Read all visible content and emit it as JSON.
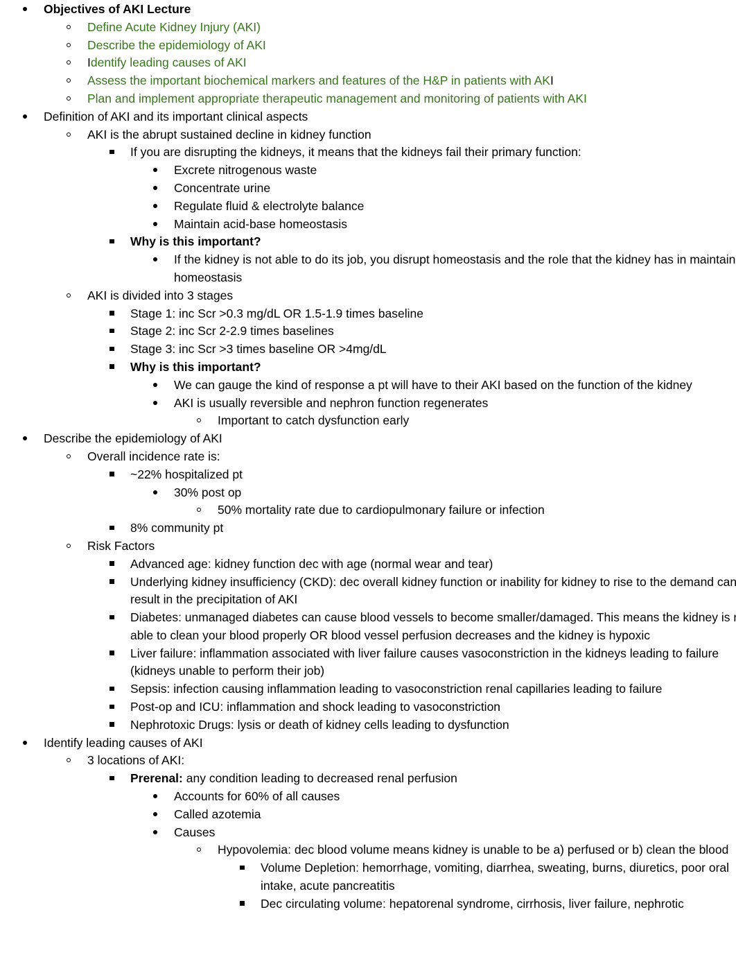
{
  "document": {
    "accent_green": "#38761d",
    "text_color": "#000000",
    "background": "#ffffff",
    "bullet_markers": {
      "level1": "filled-disc",
      "level2": "hollow-circle",
      "level3": "filled-square",
      "level4": "filled-disc",
      "level5": "hollow-circle",
      "level6": "filled-square"
    },
    "outline": [
      {
        "id": "obj-heading",
        "level": 1,
        "bullet": "disc",
        "bold": true,
        "color": "black",
        "text": "Objectives of AKI Lecture"
      },
      {
        "id": "obj-1",
        "level": 2,
        "bullet": "circ",
        "color": "green",
        "text": "Define Acute Kidney Injury (AKI)"
      },
      {
        "id": "obj-2",
        "level": 2,
        "bullet": "circ",
        "color": "green",
        "text": "Describe the epidemiology of AKI"
      },
      {
        "id": "obj-3",
        "level": 2,
        "bullet": "circ",
        "color": "green",
        "text_lead_black": "I",
        "text_rest_green": "dentify leading causes of AKI"
      },
      {
        "id": "obj-4",
        "level": 2,
        "bullet": "circ",
        "color": "green",
        "text_rest_green": "Assess the important biochemical markers and features of the H&P in patients with AK",
        "text_tail_black": "I"
      },
      {
        "id": "obj-5",
        "level": 2,
        "bullet": "circ",
        "color": "green",
        "text": "Plan and implement appropriate therapeutic management and monitoring of patients with AKI"
      },
      {
        "id": "def-heading",
        "level": 1,
        "bullet": "disc",
        "text": "Definition of AKI and its important clinical aspects"
      },
      {
        "id": "def-1",
        "level": 2,
        "bullet": "circ",
        "text": "AKI is the abrupt sustained decline in kidney function"
      },
      {
        "id": "def-1-a",
        "level": 3,
        "bullet": "sq",
        "text": "If you are disrupting the kidneys, it means that the kidneys fail their primary function:"
      },
      {
        "id": "fn-1",
        "level": 4,
        "bullet": "disc",
        "text": "Excrete nitrogenous waste"
      },
      {
        "id": "fn-2",
        "level": 4,
        "bullet": "disc",
        "text": "Concentrate urine"
      },
      {
        "id": "fn-3",
        "level": 4,
        "bullet": "disc",
        "text": "Regulate fluid & electrolyte balance"
      },
      {
        "id": "fn-4",
        "level": 4,
        "bullet": "disc",
        "text": "Maintain acid-base homeostasis"
      },
      {
        "id": "why-1",
        "level": 3,
        "bullet": "sq",
        "bold": true,
        "text": "Why is this important?"
      },
      {
        "id": "why-1-a",
        "level": 4,
        "bullet": "disc",
        "text": "If the kidney is not able to do its job, you disrupt homeostasis and the role that the kidney has in maintaining homeostasis"
      },
      {
        "id": "stages-heading",
        "level": 2,
        "bullet": "circ",
        "text": "AKI is divided into 3 stages"
      },
      {
        "id": "stage-1",
        "level": 3,
        "bullet": "sq",
        "text": "Stage 1: inc Scr >0.3 mg/dL OR 1.5-1.9 times baseline"
      },
      {
        "id": "stage-2",
        "level": 3,
        "bullet": "sq",
        "text": "Stage 2: inc Scr 2-2.9 times baselines"
      },
      {
        "id": "stage-3",
        "level": 3,
        "bullet": "sq",
        "text": "Stage 3: inc Scr >3 times baseline OR >4mg/dL"
      },
      {
        "id": "why-2",
        "level": 3,
        "bullet": "sq",
        "bold": true,
        "text": "Why is this important?"
      },
      {
        "id": "why-2-a",
        "level": 4,
        "bullet": "disc",
        "text": "We can gauge the kind of response a pt will have to their AKI based on the function of the kidney"
      },
      {
        "id": "why-2-b",
        "level": 4,
        "bullet": "disc",
        "text": "AKI is usually reversible and nephron function regenerates"
      },
      {
        "id": "why-2-b-i",
        "level": 5,
        "bullet": "circ",
        "text": "Important to catch dysfunction early"
      },
      {
        "id": "epi-heading",
        "level": 1,
        "bullet": "disc",
        "text": "Describe the epidemiology of AKI"
      },
      {
        "id": "epi-incidence",
        "level": 2,
        "bullet": "circ",
        "text": "Overall incidence rate is:"
      },
      {
        "id": "epi-hosp",
        "level": 3,
        "bullet": "sq",
        "text": "~22% hospitalized pt"
      },
      {
        "id": "epi-postop",
        "level": 4,
        "bullet": "disc",
        "text": "30% post op"
      },
      {
        "id": "epi-mortality",
        "level": 5,
        "bullet": "circ",
        "text": "50% mortality rate due to cardiopulmonary failure or infection"
      },
      {
        "id": "epi-community",
        "level": 3,
        "bullet": "sq",
        "text": "8% community pt"
      },
      {
        "id": "risk-heading",
        "level": 2,
        "bullet": "circ",
        "text": "Risk Factors"
      },
      {
        "id": "risk-age",
        "level": 3,
        "bullet": "sq",
        "text": "Advanced age: kidney function dec with age (normal wear and tear)"
      },
      {
        "id": "risk-ckd",
        "level": 3,
        "bullet": "sq",
        "text": "Underlying kidney insufficiency (CKD): dec overall kidney function or inability for kidney to rise to the demand can result in the precipitation of AKI"
      },
      {
        "id": "risk-diabetes",
        "level": 3,
        "bullet": "sq",
        "text": "Diabetes: unmanaged diabetes can cause blood vessels to become smaller/damaged. This means the kidney is not able to clean your blood properly OR blood vessel perfusion decreases and the kidney is hypoxic"
      },
      {
        "id": "risk-liver",
        "level": 3,
        "bullet": "sq",
        "text": "Liver failure: inflammation associated with liver failure causes vasoconstriction in the kidneys leading to failure (kidneys unable to perform their job)"
      },
      {
        "id": "risk-sepsis",
        "level": 3,
        "bullet": "sq",
        "text": "Sepsis: infection causing inflammation leading to vasoconstriction renal capillaries leading to failure"
      },
      {
        "id": "risk-postop-icu",
        "level": 3,
        "bullet": "sq",
        "text": "Post-op and ICU: inflammation and shock leading to vasoconstriction"
      },
      {
        "id": "risk-drugs",
        "level": 3,
        "bullet": "sq",
        "text": "Nephrotoxic Drugs: lysis or death of kidney cells leading to dysfunction"
      },
      {
        "id": "causes-heading",
        "level": 1,
        "bullet": "disc",
        "text": "Identify leading causes of AKI"
      },
      {
        "id": "causes-locations",
        "level": 2,
        "bullet": "circ",
        "text": "3 locations of AKI:"
      },
      {
        "id": "prerenal",
        "level": 3,
        "bullet": "sq",
        "bold_lead": "Prerenal:",
        "text_rest": " any condition leading to decreased renal perfusion"
      },
      {
        "id": "prerenal-pct",
        "level": 4,
        "bullet": "disc",
        "text": "Accounts for 60% of all causes"
      },
      {
        "id": "prerenal-azotemia",
        "level": 4,
        "bullet": "disc",
        "text": "Called azotemia"
      },
      {
        "id": "prerenal-causes",
        "level": 4,
        "bullet": "disc",
        "text": "Causes"
      },
      {
        "id": "hypovolemia",
        "level": 5,
        "bullet": "circ",
        "text": "Hypovolemia: dec blood volume means kidney is unable to be a) perfused or b) clean the blood"
      },
      {
        "id": "volume-depletion",
        "level": 6,
        "bullet": "sq",
        "text": "Volume Depletion: hemorrhage, vomiting, diarrhea, sweating, burns, diuretics, poor oral intake, acute pancreatitis"
      },
      {
        "id": "dec-circ-volume",
        "level": 6,
        "bullet": "sq",
        "text": "Dec circulating volume: hepatorenal syndrome, cirrhosis, liver failure, nephrotic"
      }
    ]
  }
}
